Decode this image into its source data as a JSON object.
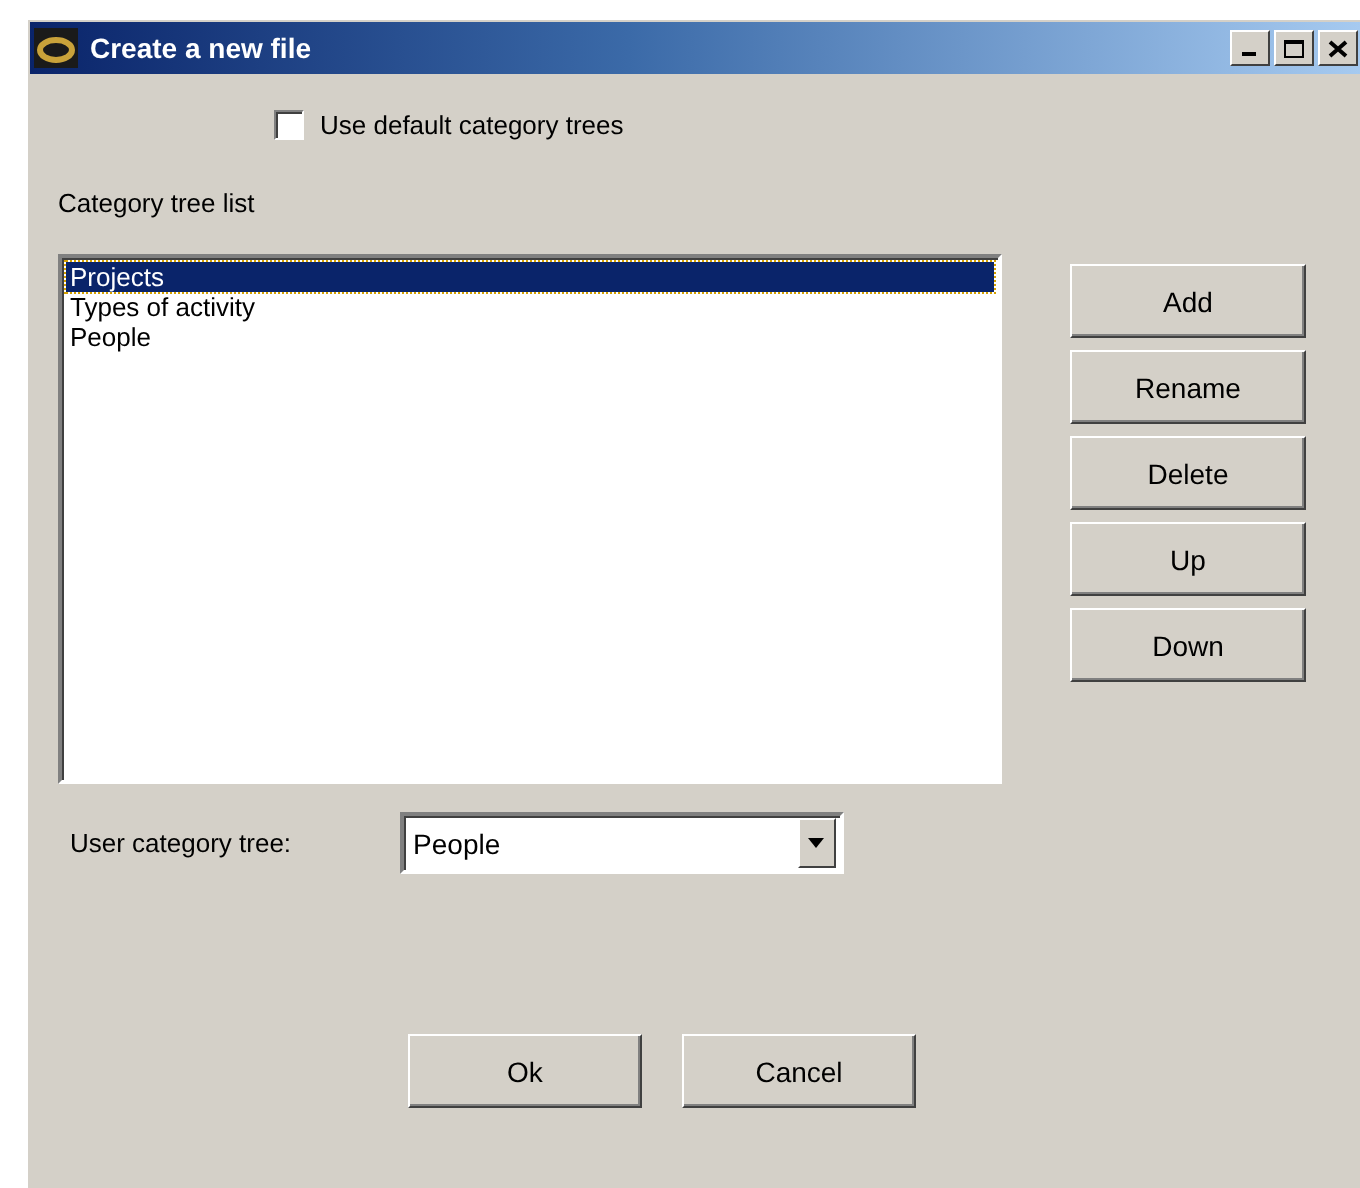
{
  "window": {
    "title": "Create a new file"
  },
  "use_default_checkbox": {
    "label": "Use default category trees",
    "checked": false
  },
  "category_list": {
    "label": "Category tree list",
    "items": [
      {
        "label": "Projects",
        "selected": true
      },
      {
        "label": "Types of activity",
        "selected": false
      },
      {
        "label": "People",
        "selected": false
      }
    ]
  },
  "side_buttons": [
    "Add",
    "Rename",
    "Delete",
    "Up",
    "Down"
  ],
  "user_category_tree": {
    "label": "User category tree:",
    "value": "People"
  },
  "buttons": [
    "Ok",
    "Cancel"
  ]
}
